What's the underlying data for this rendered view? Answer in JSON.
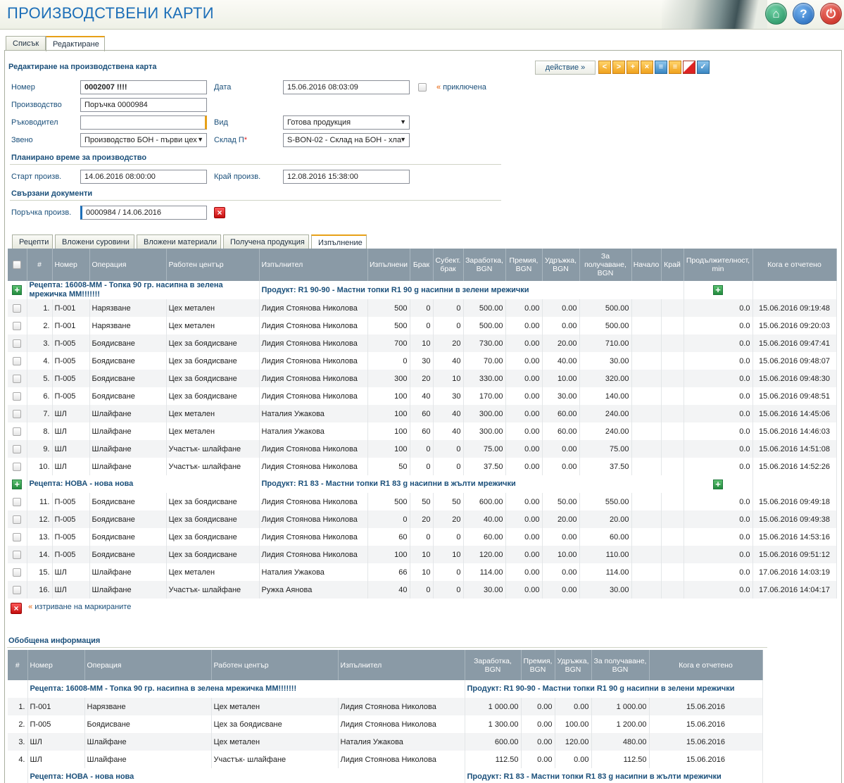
{
  "header": {
    "title": "ПРОИЗВОДСТВЕНИ КАРТИ",
    "home_icon": "home-icon",
    "help_icon": "help-icon",
    "power_icon": "power-icon"
  },
  "tabs": [
    "Списък",
    "Редактиране"
  ],
  "form": {
    "section_title": "Редактиране на производствена карта",
    "action_label": "действие  »",
    "number_label": "Номер",
    "number_value": "0002007 !!!!",
    "date_label": "Дата",
    "date_value": "15.06.2016 08:03:09",
    "closed_label": "приключена",
    "production_label": "Производство",
    "production_value": "Поръчка 0000984",
    "manager_label": "Ръководител",
    "manager_value": "",
    "kind_label": "Вид",
    "kind_value": "Готова продукция",
    "unit_label": "Звено",
    "unit_value": "Производство БОН - първи цех",
    "warehouse_label": "Склад П",
    "warehouse_value": "S-BON-02 - Склад на БОН - хла",
    "planned_title": "Планирано време за производство",
    "start_label": "Старт произв.",
    "start_value": "14.06.2016 08:00:00",
    "end_label": "Край произв.",
    "end_value": "12.08.2016 15:38:00",
    "docs_title": "Свързани документи",
    "order_label": "Поръчка произв.",
    "order_value": "0000984 / 14.06.2016"
  },
  "inner_tabs": [
    "Рецепти",
    "Вложени суровини",
    "Вложени материали",
    "Получена продукция",
    "Изпълнение"
  ],
  "exec_table": {
    "headers": [
      "#",
      "Номер",
      "Операция",
      "Работен център",
      "Изпълнител",
      "Изпълнени",
      "Брак",
      "Субект. брак",
      "Заработка, BGN",
      "Премия, BGN",
      "Удръжка, BGN",
      "За получаване, BGN",
      "Начало",
      "Край",
      "Продължителност, min",
      "Кога е отчетено"
    ],
    "groups": [
      {
        "recipe": "Рецепта: 16008-ММ - Топка 90 гр. насипна в зелена мрежичка ММ!!!!!!!",
        "product": "Продукт: R1 90-90 - Мастни топки R1 90 g насипни в зелени мрежички",
        "rows": [
          [
            "1.",
            "П-001",
            "Нарязване",
            "Цех метален",
            "Лидия Стоянова Николова",
            "500",
            "0",
            "0",
            "500.00",
            "0.00",
            "0.00",
            "500.00",
            "",
            "",
            "0.0",
            "15.06.2016 09:19:48"
          ],
          [
            "2.",
            "П-001",
            "Нарязване",
            "Цех метален",
            "Лидия Стоянова Николова",
            "500",
            "0",
            "0",
            "500.00",
            "0.00",
            "0.00",
            "500.00",
            "",
            "",
            "0.0",
            "15.06.2016 09:20:03"
          ],
          [
            "3.",
            "П-005",
            "Боядисване",
            "Цех за боядисване",
            "Лидия Стоянова Николова",
            "700",
            "10",
            "20",
            "730.00",
            "0.00",
            "20.00",
            "710.00",
            "",
            "",
            "0.0",
            "15.06.2016 09:47:41"
          ],
          [
            "4.",
            "П-005",
            "Боядисване",
            "Цех за боядисване",
            "Лидия Стоянова Николова",
            "0",
            "30",
            "40",
            "70.00",
            "0.00",
            "40.00",
            "30.00",
            "",
            "",
            "0.0",
            "15.06.2016 09:48:07"
          ],
          [
            "5.",
            "П-005",
            "Боядисване",
            "Цех за боядисване",
            "Лидия Стоянова Николова",
            "300",
            "20",
            "10",
            "330.00",
            "0.00",
            "10.00",
            "320.00",
            "",
            "",
            "0.0",
            "15.06.2016 09:48:30"
          ],
          [
            "6.",
            "П-005",
            "Боядисване",
            "Цех за боядисване",
            "Лидия Стоянова Николова",
            "100",
            "40",
            "30",
            "170.00",
            "0.00",
            "30.00",
            "140.00",
            "",
            "",
            "0.0",
            "15.06.2016 09:48:51"
          ],
          [
            "7.",
            "ШЛ",
            "Шлайфане",
            "Цех метален",
            "Наталия Ужакова",
            "100",
            "60",
            "40",
            "300.00",
            "0.00",
            "60.00",
            "240.00",
            "",
            "",
            "0.0",
            "15.06.2016 14:45:06"
          ],
          [
            "8.",
            "ШЛ",
            "Шлайфане",
            "Цех метален",
            "Наталия Ужакова",
            "100",
            "60",
            "40",
            "300.00",
            "0.00",
            "60.00",
            "240.00",
            "",
            "",
            "0.0",
            "15.06.2016 14:46:03"
          ],
          [
            "9.",
            "ШЛ",
            "Шлайфане",
            "Участък- шлайфане",
            "Лидия Стоянова Николова",
            "100",
            "0",
            "0",
            "75.00",
            "0.00",
            "0.00",
            "75.00",
            "",
            "",
            "0.0",
            "15.06.2016 14:51:08"
          ],
          [
            "10.",
            "ШЛ",
            "Шлайфане",
            "Участък- шлайфане",
            "Лидия Стоянова Николова",
            "50",
            "0",
            "0",
            "37.50",
            "0.00",
            "0.00",
            "37.50",
            "",
            "",
            "0.0",
            "15.06.2016 14:52:26"
          ]
        ]
      },
      {
        "recipe": "Рецепта: НОВА - нова нова",
        "product": "Продукт: R1 83 - Мастни топки R1 83 g насипни в жълти мрежички",
        "rows": [
          [
            "11.",
            "П-005",
            "Боядисване",
            "Цех за боядисване",
            "Лидия Стоянова Николова",
            "500",
            "50",
            "50",
            "600.00",
            "0.00",
            "50.00",
            "550.00",
            "",
            "",
            "0.0",
            "15.06.2016 09:49:18"
          ],
          [
            "12.",
            "П-005",
            "Боядисване",
            "Цех за боядисване",
            "Лидия Стоянова Николова",
            "0",
            "20",
            "20",
            "40.00",
            "0.00",
            "20.00",
            "20.00",
            "",
            "",
            "0.0",
            "15.06.2016 09:49:38"
          ],
          [
            "13.",
            "П-005",
            "Боядисване",
            "Цех за боядисване",
            "Лидия Стоянова Николова",
            "60",
            "0",
            "0",
            "60.00",
            "0.00",
            "0.00",
            "60.00",
            "",
            "",
            "0.0",
            "15.06.2016 14:53:16"
          ],
          [
            "14.",
            "П-005",
            "Боядисване",
            "Цех за боядисване",
            "Лидия Стоянова Николова",
            "100",
            "10",
            "10",
            "120.00",
            "0.00",
            "10.00",
            "110.00",
            "",
            "",
            "0.0",
            "15.06.2016 09:51:12"
          ],
          [
            "15.",
            "ШЛ",
            "Шлайфане",
            "Цех метален",
            "Наталия Ужакова",
            "66",
            "10",
            "0",
            "114.00",
            "0.00",
            "0.00",
            "114.00",
            "",
            "",
            "0.0",
            "17.06.2016 14:03:19"
          ],
          [
            "16.",
            "ШЛ",
            "Шлайфане",
            "Участък- шлайфане",
            "Ружка Аянова",
            "40",
            "0",
            "0",
            "30.00",
            "0.00",
            "0.00",
            "30.00",
            "",
            "",
            "0.0",
            "17.06.2016 14:04:17"
          ]
        ]
      }
    ],
    "delete_label": "изтриване на маркираните"
  },
  "summary": {
    "title": "Обобщена информация",
    "headers": [
      "#",
      "Номер",
      "Операция",
      "Работен център",
      "Изпълнител",
      "Заработка, BGN",
      "Премия, BGN",
      "Удръжка, BGN",
      "За получаване, BGN",
      "Кога е отчетено"
    ],
    "groups": [
      {
        "recipe": "Рецепта: 16008-ММ - Топка 90 гр. насипна в зелена мрежичка ММ!!!!!!!",
        "product": "Продукт: R1 90-90 - Мастни топки R1 90 g насипни в зелени мрежички",
        "rows": [
          [
            "1.",
            "П-001",
            "Нарязване",
            "Цех метален",
            "Лидия Стоянова Николова",
            "1 000.00",
            "0.00",
            "0.00",
            "1 000.00",
            "15.06.2016"
          ],
          [
            "2.",
            "П-005",
            "Боядисване",
            "Цех за боядисване",
            "Лидия Стоянова Николова",
            "1 300.00",
            "0.00",
            "100.00",
            "1 200.00",
            "15.06.2016"
          ],
          [
            "3.",
            "ШЛ",
            "Шлайфане",
            "Цех метален",
            "Наталия Ужакова",
            "600.00",
            "0.00",
            "120.00",
            "480.00",
            "15.06.2016"
          ],
          [
            "4.",
            "ШЛ",
            "Шлайфане",
            "Участък- шлайфане",
            "Лидия Стоянова Николова",
            "112.50",
            "0.00",
            "0.00",
            "112.50",
            "15.06.2016"
          ]
        ]
      },
      {
        "recipe": "Рецепта: НОВА - нова нова",
        "product": "Продукт: R1 83 - Мастни топки R1 83 g насипни в жълти мрежички",
        "rows": []
      }
    ]
  }
}
